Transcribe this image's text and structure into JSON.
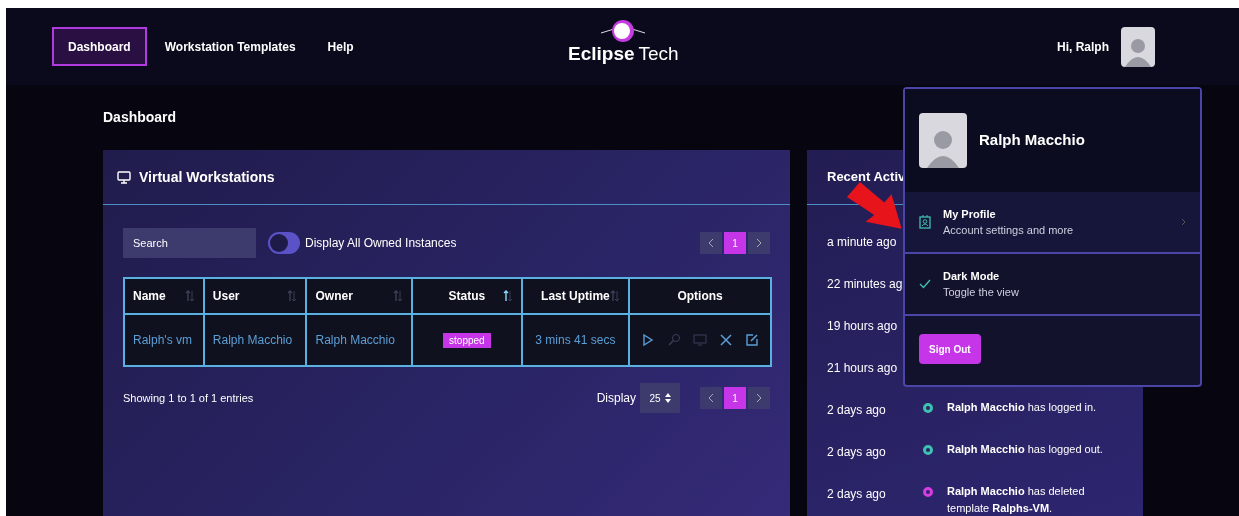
{
  "nav": {
    "items": [
      {
        "label": "Dashboard",
        "selected": true
      },
      {
        "label": "Workstation Templates",
        "selected": false
      },
      {
        "label": "Help",
        "selected": false
      }
    ],
    "logo": {
      "bold": "Eclipse",
      "light": "Tech"
    },
    "greeting": "Hi, Ralph"
  },
  "page_title": "Dashboard",
  "workstations": {
    "title": "Virtual Workstations",
    "search": {
      "placeholder": "Search"
    },
    "toggle": {
      "label": "Display All Owned Instances",
      "on": false
    },
    "pages": [
      {
        "label": "1",
        "selected": true
      }
    ],
    "columns": [
      {
        "label": "Name",
        "sorted": false
      },
      {
        "label": "User",
        "sorted": false
      },
      {
        "label": "Owner",
        "sorted": false
      },
      {
        "label": "Status",
        "sorted": true
      },
      {
        "label": "Last Uptime",
        "sorted": false
      },
      {
        "label": "Options"
      }
    ],
    "rows": [
      {
        "name": "Ralph's vm",
        "user": "Ralph Macchio",
        "owner": "Ralph Macchio",
        "status": "stopped",
        "uptime": "3 mins 41 secs",
        "actions": [
          {
            "kind": "play",
            "disabled": false
          },
          {
            "kind": "key",
            "disabled": true
          },
          {
            "kind": "monitor",
            "disabled": true
          },
          {
            "kind": "delete",
            "disabled": false
          },
          {
            "kind": "edit",
            "disabled": false
          }
        ]
      }
    ],
    "info": "Showing 1 to 1 of 1 entries",
    "display_label": "Display",
    "page_size": "25",
    "footer_pages": [
      {
        "label": "1",
        "selected": true
      }
    ]
  },
  "activity": {
    "title": "Recent Activ",
    "items": [
      {
        "time": "a minute ago"
      },
      {
        "time": "22 minutes ag"
      },
      {
        "time": "19 hours ago"
      },
      {
        "time": "21 hours ago"
      },
      {
        "time": "2 days ago",
        "message": "**Ralph Macchio** has logged in.",
        "color": "#3fc1b0"
      },
      {
        "time": "2 days ago",
        "message": "**Ralph Macchio** has logged out.",
        "color": "#3fc1b0"
      },
      {
        "time": "2 days ago",
        "message": "**Ralph Macchio** has deleted template **Ralphs-VM**.",
        "color": "#d63ce0"
      }
    ]
  },
  "user_menu": {
    "name": "Ralph Macchio",
    "items": [
      {
        "kind": "link",
        "title": "My Profile",
        "subtitle": "Account settings and more"
      },
      {
        "kind": "check",
        "title": "Dark Mode",
        "subtitle": "Toggle the view",
        "checked": true
      }
    ],
    "sign_out": "Sign Out"
  }
}
